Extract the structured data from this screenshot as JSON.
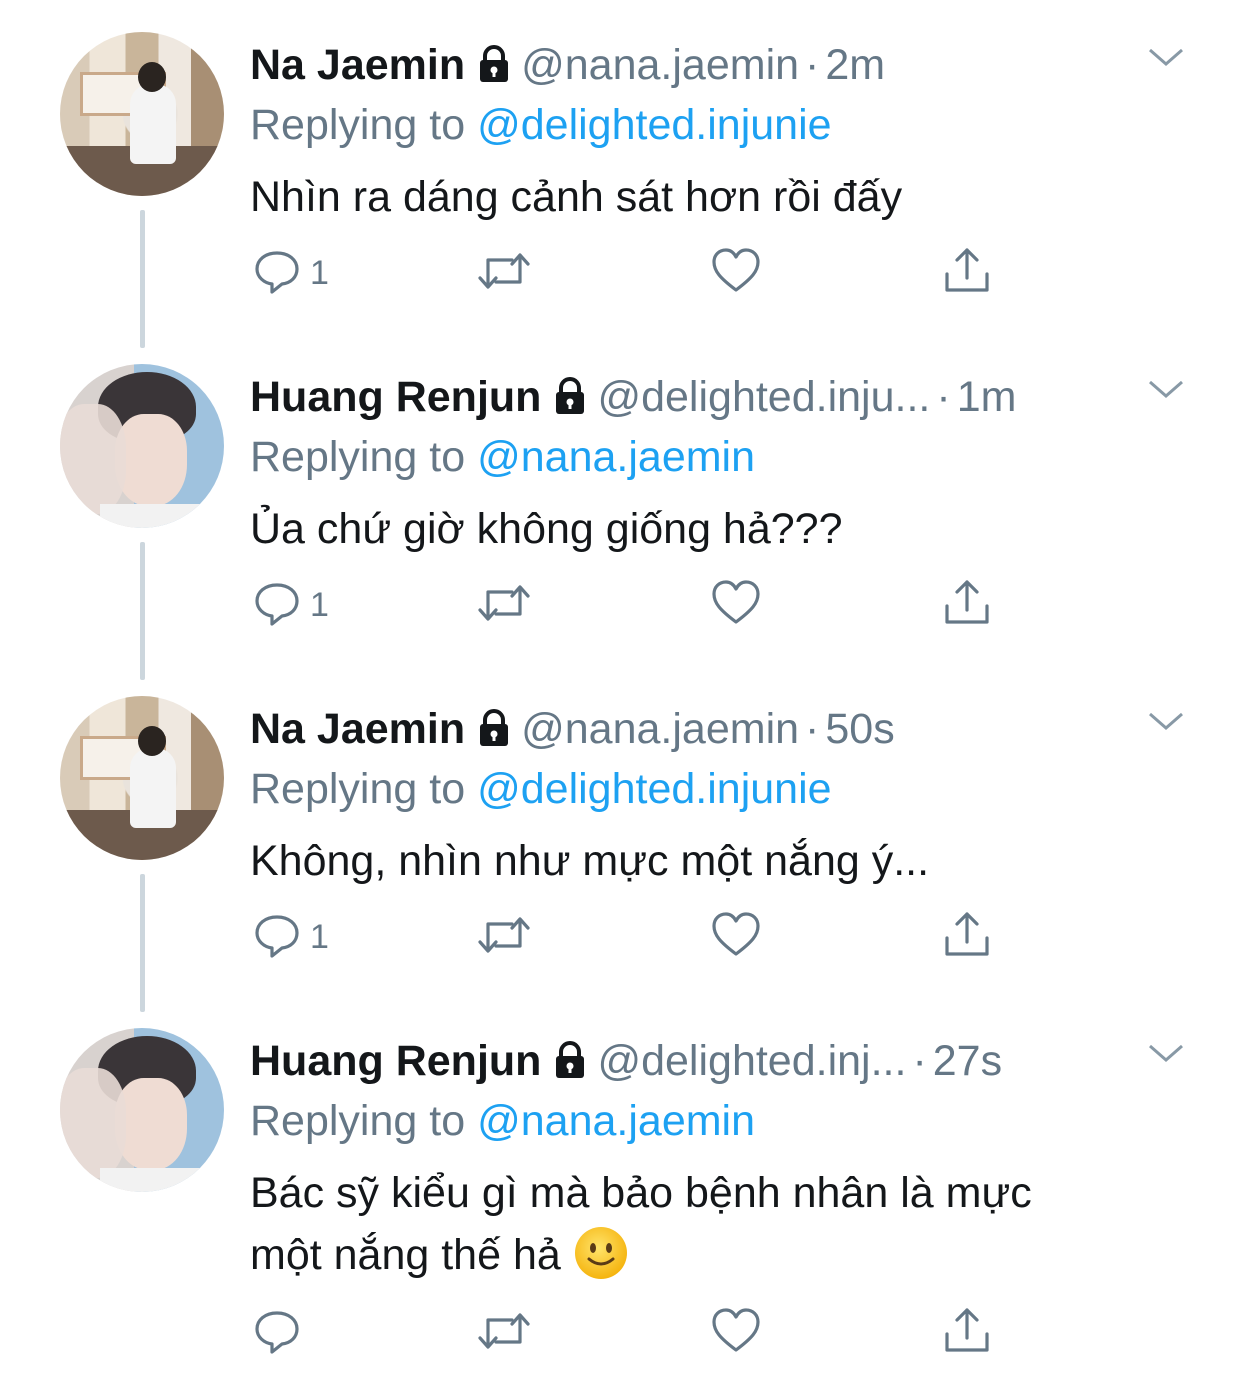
{
  "tweets": [
    {
      "name": "Na Jaemin",
      "handle": "@nana.jaemin",
      "separator": "·",
      "time": "2m",
      "reply_prefix": "Replying to",
      "reply_to": "@delighted.injunie",
      "text": "Nhìn ra dáng cảnh sát hơn rồi đấy",
      "reply_count": "1",
      "avatar": "kitchen-photo-avatar"
    },
    {
      "name": "Huang Renjun",
      "handle": "@delighted.inju...",
      "separator": "·",
      "time": "1m",
      "reply_prefix": "Replying to",
      "reply_to": "@nana.jaemin",
      "text": "Ủa chứ giờ không giống hả???",
      "reply_count": "1",
      "avatar": "portrait-photo-avatar"
    },
    {
      "name": "Na Jaemin",
      "handle": "@nana.jaemin",
      "separator": "·",
      "time": "50s",
      "reply_prefix": "Replying to",
      "reply_to": "@delighted.injunie",
      "text": "Không, nhìn như mực một nắng ý...",
      "reply_count": "1",
      "avatar": "kitchen-photo-avatar"
    },
    {
      "name": "Huang Renjun",
      "handle": "@delighted.inj...",
      "separator": "·",
      "time": "27s",
      "reply_prefix": "Replying to",
      "reply_to": "@nana.jaemin",
      "text_line1": "Bác sỹ kiểu gì mà bảo bệnh nhân là mực",
      "text_line2": "một nắng thế hả",
      "reply_count": "",
      "avatar": "portrait-photo-avatar",
      "emoji": "slightly-smiling-face-emoji"
    }
  ],
  "icons": {
    "reply": "reply-icon",
    "retweet": "retweet-icon",
    "like": "heart-icon",
    "share": "share-icon",
    "lock": "lock-icon",
    "menu": "chevron-down-icon"
  },
  "colors": {
    "text": "#14171a",
    "secondary": "#657786",
    "link": "#1da1f2",
    "thread_line": "#ccd6dd"
  }
}
